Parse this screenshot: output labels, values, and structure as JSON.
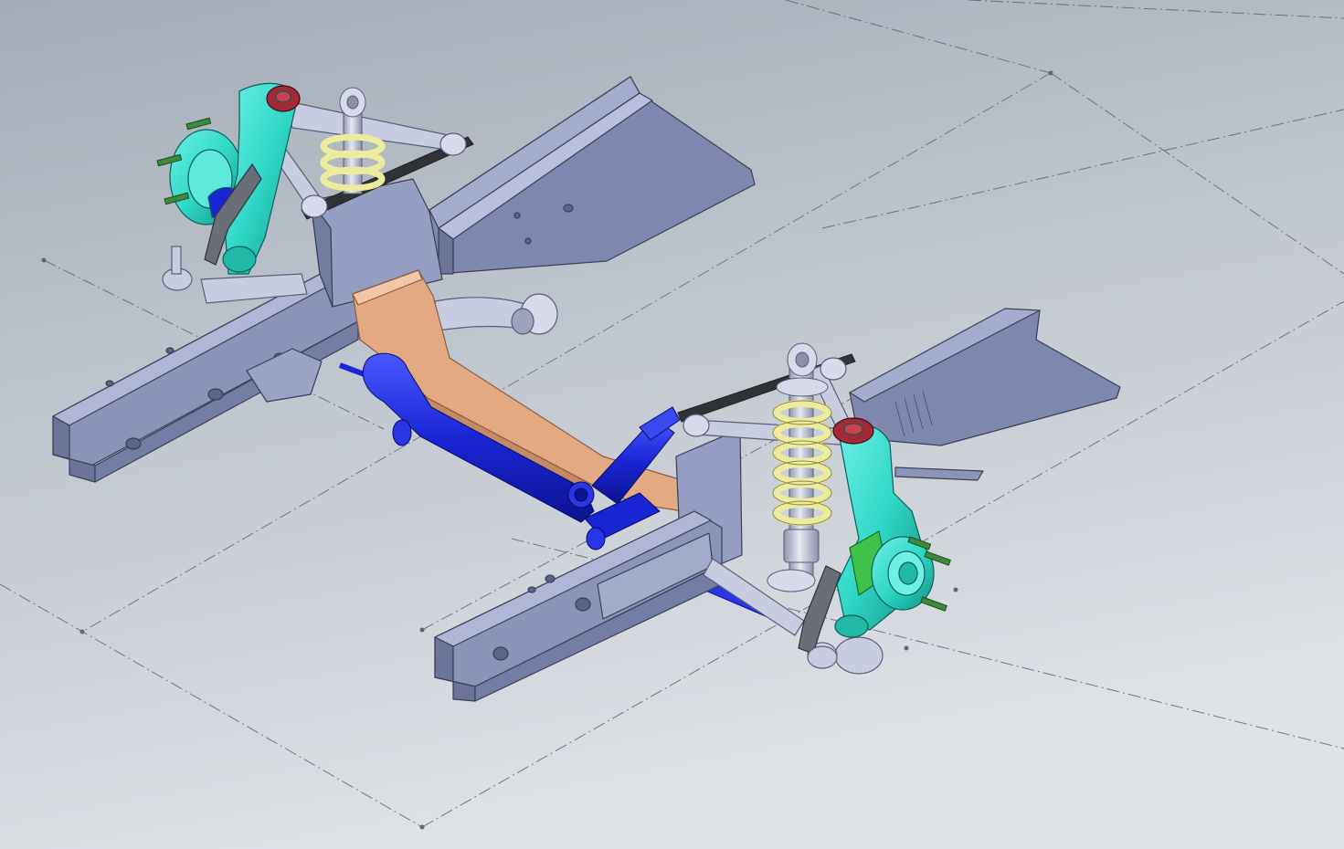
{
  "viewport": {
    "background_top": "#a3acb8",
    "background_bottom": "#dfe2e7"
  },
  "colors": {
    "frame_fill": "#8a93b8",
    "frame_light": "#a5adcf",
    "frame_dark": "#6c7499",
    "frame_edge": "#3a3f55",
    "crossmember": "#e3a982",
    "crossmember_dark": "#c48a66",
    "rack_blue": "#1a25d6",
    "rack_blue_light": "#3a48f0",
    "knuckle_cyan": "#30d8c8",
    "knuckle_dark": "#159c90",
    "spring_yellow": "#ecec9c",
    "spring_edge": "#8b8a4c",
    "arm_silver": "#c8cce0",
    "arm_edge": "#5a5e75",
    "stud_green": "#3d8a3d",
    "sketch_line": "#5f6470"
  },
  "components": [
    "left-frame-rail-icon",
    "right-frame-rail-icon",
    "crossmember-icon",
    "steering-rack-icon",
    "front-left-knuckle-icon",
    "front-right-knuckle-icon",
    "front-left-coilover-icon",
    "front-right-coilover-icon",
    "upper-control-arm-icon",
    "lower-control-arm-icon",
    "tie-rod-icon",
    "sway-bar-icon",
    "wheel-stud-icon"
  ]
}
